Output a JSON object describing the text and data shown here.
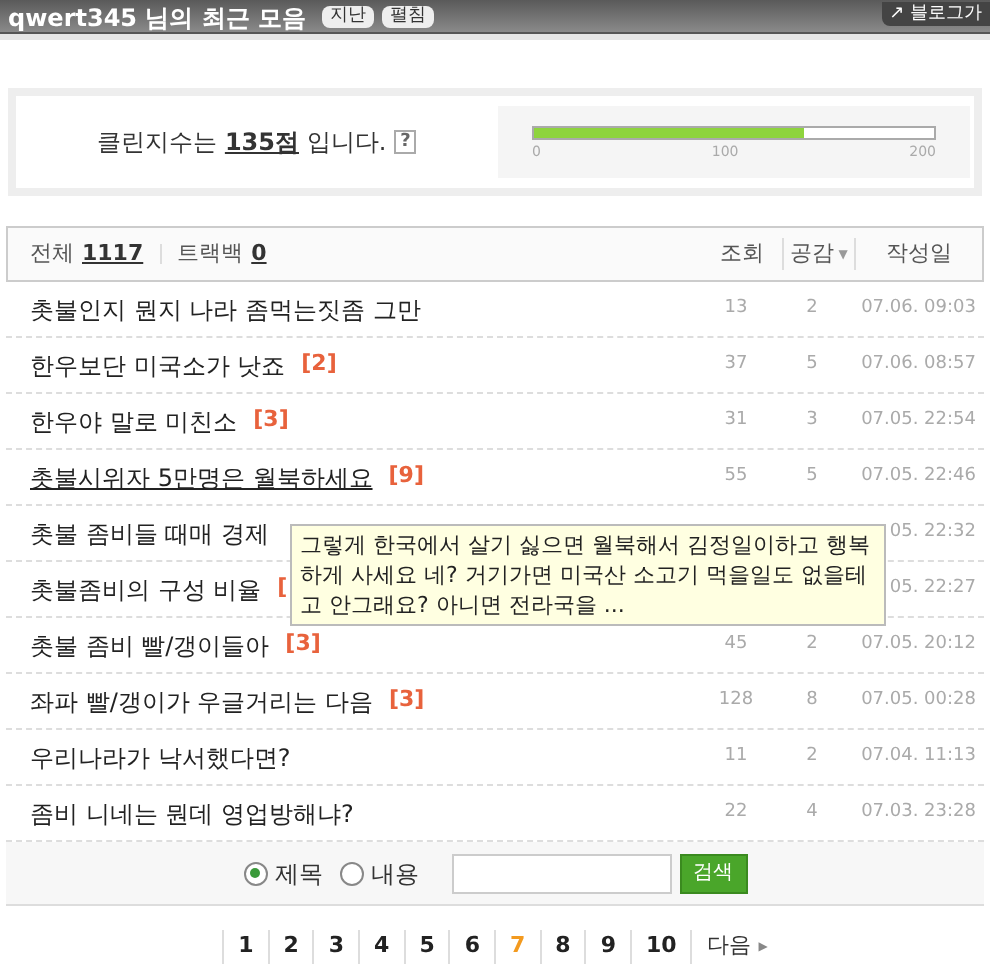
{
  "header": {
    "title": "qwert345 님의 최근 모음",
    "badges": [
      "지난",
      "펼침"
    ],
    "link": "↗ 블로그가"
  },
  "clean_index": {
    "prefix": "클린지수는 ",
    "score": "135점",
    "suffix": " 입니다.",
    "help": "?",
    "level": 0.675,
    "scale": [
      "0",
      "100",
      "200"
    ]
  },
  "list_header": {
    "total_label": "전체",
    "total": "1117",
    "trackback_label": "트랙백",
    "trackback": "0",
    "columns": [
      "조회",
      "공감",
      "작성일"
    ],
    "sort_icon": "▼"
  },
  "posts": [
    {
      "title": "촛불인지 뭔지 나라 좀먹는짓좀 그만",
      "views": "13",
      "likes": "2",
      "date": "07.06. 09:03",
      "hovered": false
    },
    {
      "title": "한우보단 미국소가 낫죠",
      "comments": "[2]",
      "views": "37",
      "likes": "5",
      "date": "07.06. 08:57",
      "hovered": false
    },
    {
      "title": "한우야 말로 미친소",
      "comments": "[3]",
      "views": "31",
      "likes": "3",
      "date": "07.05. 22:54",
      "hovered": false
    },
    {
      "title": "촛불시위자 5만명은 월북하세요",
      "comments": "[9]",
      "views": "55",
      "likes": "5",
      "date": "07.05. 22:46",
      "hovered": true
    },
    {
      "title": "촛불 좀비들 때매 경제",
      "date": "05. 22:32",
      "hovered": false
    },
    {
      "title": "촛불좀비의 구성 비율",
      "comments": "[",
      "date": "05. 22:27",
      "hovered": false
    },
    {
      "title": "촛불 좀비 빨/갱이들아",
      "comments": "[3]",
      "views": "45",
      "likes": "2",
      "date": "07.05. 20:12",
      "hovered": false
    },
    {
      "title": "좌파 빨/갱이가 우글거리는 다음",
      "comments": "[3]",
      "views": "128",
      "likes": "8",
      "date": "07.05. 00:28",
      "hovered": false
    },
    {
      "title": "우리나라가 낙서했다면?",
      "views": "11",
      "likes": "2",
      "date": "07.04. 11:13",
      "hovered": false
    },
    {
      "title": "좀비 니네는 뭔데 영업방해냐?",
      "views": "22",
      "likes": "4",
      "date": "07.03. 23:28",
      "hovered": false
    }
  ],
  "tooltip": "그렇게 한국에서 살기 싫으면 월북해서 김정일이하고 행복하게 사세요 네? 거기가면 미국산 소고기 먹을일도 없을테고 안그래요? 아니면 전라국을 ...",
  "search": {
    "options": [
      {
        "label": "제목",
        "selected": true
      },
      {
        "label": "내용",
        "selected": false
      }
    ],
    "button": "검색"
  },
  "pagination": {
    "pages": [
      {
        "label": "1",
        "selected": false
      },
      {
        "label": "2",
        "selected": false
      },
      {
        "label": "3",
        "selected": false
      },
      {
        "label": "4",
        "selected": false
      },
      {
        "label": "5",
        "selected": false
      },
      {
        "label": "6",
        "selected": false
      },
      {
        "label": "7",
        "selected": true
      },
      {
        "label": "8",
        "selected": false
      },
      {
        "label": "9",
        "selected": false
      },
      {
        "label": "10",
        "selected": false
      }
    ],
    "next": "다음",
    "next_icon": "▶"
  }
}
